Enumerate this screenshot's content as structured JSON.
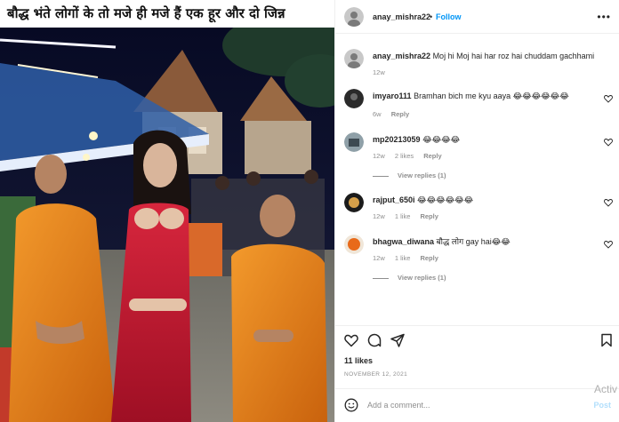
{
  "post": {
    "caption": "बौद्ध भंते लोगों के तो मजे ही मजे हैं एक हूर और दो जिन्न"
  },
  "header": {
    "username": "anay_mishra22",
    "separator": "•",
    "follow_label": "Follow",
    "more_label": "•••"
  },
  "author_comment": {
    "username": "anay_mishra22",
    "text": "Moj hi Moj hai har roz hai chuddam gachhami",
    "time": "12w"
  },
  "comments": [
    {
      "username": "imyaro111",
      "text": "Bramhan bich me kyu aaya 😂😂😂😂😂😂",
      "time": "6w",
      "likes": "",
      "reply": "Reply"
    },
    {
      "username": "mp20213059",
      "text": "😂😂😂😂",
      "time": "12w",
      "likes": "2 likes",
      "reply": "Reply",
      "view_replies": "View replies (1)"
    },
    {
      "username": "rajput_650i",
      "text": "😂😂😂😂😂😂",
      "time": "12w",
      "likes": "1 like",
      "reply": "Reply"
    },
    {
      "username": "bhagwa_diwana",
      "text": "बौद्ध लोग gay hai😂😂",
      "time": "12w",
      "likes": "1 like",
      "reply": "Reply",
      "view_replies": "View replies (1)"
    }
  ],
  "stats": {
    "likes": "11 likes",
    "date": "NOVEMBER 12, 2021"
  },
  "add_comment": {
    "placeholder": "Add a comment...",
    "post_label": "Post"
  },
  "watermark": "Activ",
  "colors": {
    "link": "#0095f6",
    "muted": "#8e8e8e",
    "robe": "#e07a16",
    "dress": "#c8102e"
  }
}
